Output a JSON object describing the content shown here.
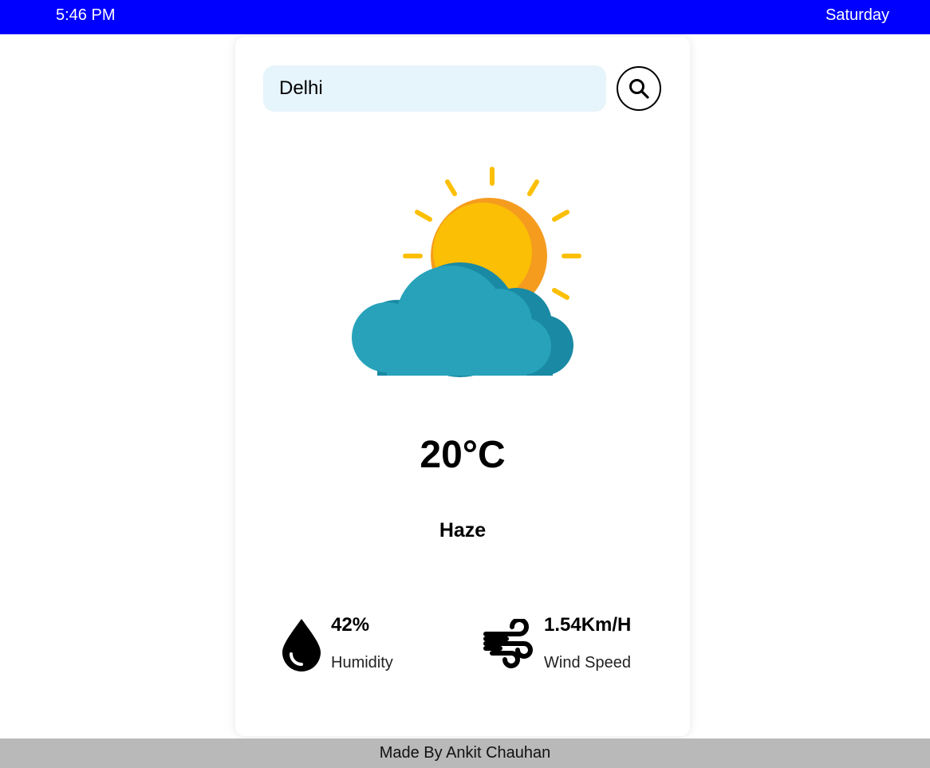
{
  "header": {
    "time": "5:46 PM",
    "day": "Saturday",
    "bg_color": "#0000ff"
  },
  "search": {
    "value": "Delhi",
    "button_icon": "search-icon"
  },
  "weather": {
    "icon": "sun-behind-cloud-icon",
    "temperature": "20°C",
    "condition": "Haze"
  },
  "stats": {
    "humidity": {
      "icon": "water-drop-icon",
      "value": "42%",
      "label": "Humidity"
    },
    "wind": {
      "icon": "wind-icon",
      "value": "1.54Km/H",
      "label": "Wind Speed"
    }
  },
  "footer": {
    "text": "Made By Ankit Chauhan"
  },
  "colors": {
    "sun": "#fbbf05",
    "sun_shade": "#f59c1f",
    "cloud": "#27a2ba",
    "cloud_shade": "#1a8aa4",
    "search_bg": "#e6f4fb",
    "footer_bg": "#b9b9b9"
  }
}
